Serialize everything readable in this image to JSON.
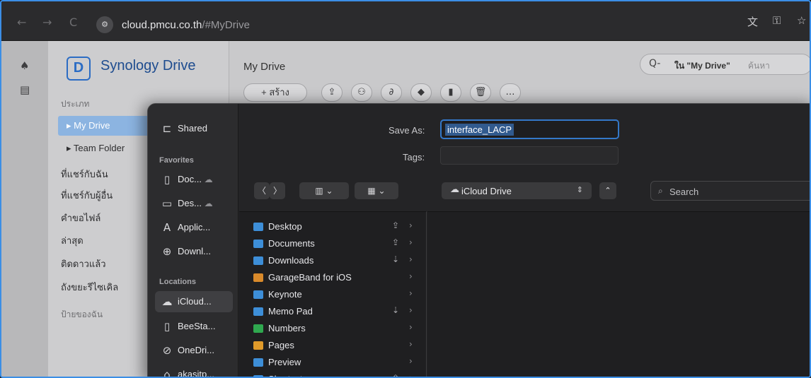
{
  "browser": {
    "back_icon": "←",
    "forward_icon": "→",
    "reload_icon": "C",
    "site_icon": "⚙",
    "url_host": "cloud.pmcu.co.th",
    "url_path": "/#MyDrive",
    "translate_icon": "文",
    "key_icon": "⚿",
    "star_icon": "☆"
  },
  "rail": {
    "bell_icon": "♠",
    "doc_icon": "▤"
  },
  "brand": {
    "logo": "D",
    "name": "Synology Drive"
  },
  "left_nav": {
    "section_type": "ประเภท",
    "items": [
      "My Drive",
      "Team Folder",
      "ที่แชร์กับฉัน",
      "ที่แชร์กับผู้อื่น",
      "คำขอไฟล์",
      "ล่าสุด",
      "ติดดาวแล้ว",
      "ถังขยะรีไซเคิล"
    ],
    "section_labels": "ป้ายของฉัน",
    "active_prefix": "▸",
    "folder_prefix": "▸"
  },
  "main": {
    "title": "My Drive",
    "create_label": "+ สร้าง",
    "toolbar_icons": [
      "⇪",
      "⚇",
      "∂",
      "◆",
      "▮",
      "🗑",
      "…"
    ]
  },
  "search": {
    "icon": "Q-",
    "scope": "ใน \"My Drive\"",
    "placeholder": "ค้นหา"
  },
  "dialog": {
    "save_as_label": "Save As:",
    "save_as_value": "interface_LACP",
    "tags_label": "Tags:",
    "location": "iCloud Drive",
    "location_icon": "☁",
    "location_chevron": "⇕",
    "up_icon": "⌃",
    "view_back": "〈",
    "view_forward": "〉",
    "column_view": "▥  ⌄",
    "grid_view": "▦  ⌄",
    "search_placeholder": "Search",
    "search_icon": "⌕",
    "sidebar": {
      "shared": "Shared",
      "favorites_header": "Favorites",
      "favorites": [
        {
          "label": "Doc...",
          "icon": "▯",
          "cloud": "☁"
        },
        {
          "label": "Des...",
          "icon": "▭",
          "cloud": "☁"
        },
        {
          "label": "Applic...",
          "icon": "A"
        },
        {
          "label": "Downl...",
          "icon": "⊕"
        }
      ],
      "locations_header": "Locations",
      "locations": [
        {
          "label": "iCloud...",
          "icon": "☁"
        },
        {
          "label": "BeeSta...",
          "icon": "▯"
        },
        {
          "label": "OneDri...",
          "icon": "⊘"
        },
        {
          "label": "akasitp...",
          "icon": "⌂"
        }
      ]
    },
    "files": [
      {
        "name": "Desktop",
        "status": "⇪",
        "color": "#3d8ed8"
      },
      {
        "name": "Documents",
        "status": "⇪",
        "color": "#3d8ed8"
      },
      {
        "name": "Downloads",
        "status": "⇣",
        "color": "#3d8ed8"
      },
      {
        "name": "GarageBand for iOS",
        "status": "",
        "color": "#d98a2b"
      },
      {
        "name": "Keynote",
        "status": "",
        "color": "#3d8ed8"
      },
      {
        "name": "Memo Pad",
        "status": "⇣",
        "color": "#3d8ed8"
      },
      {
        "name": "Numbers",
        "status": "",
        "color": "#2fa84f"
      },
      {
        "name": "Pages",
        "status": "",
        "color": "#e09a2a"
      },
      {
        "name": "Preview",
        "status": "",
        "color": "#3d8ed8"
      },
      {
        "name": "Shortcuts",
        "status": "⇪",
        "color": "#3d8ed8"
      }
    ],
    "chevron": "›"
  }
}
